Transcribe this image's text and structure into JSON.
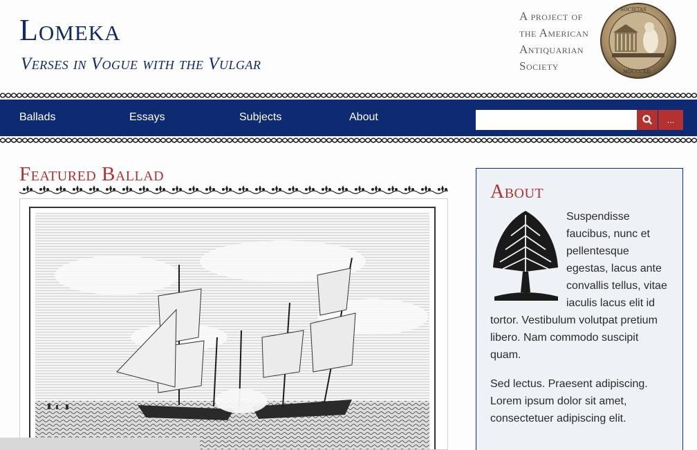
{
  "site": {
    "title": "Lomeka",
    "tagline": "Verses in Vogue with the Vulgar",
    "project_note": "A project of the American Antiquarian Society"
  },
  "nav": {
    "items": [
      {
        "label": "Ballads"
      },
      {
        "label": "Essays"
      },
      {
        "label": "Subjects"
      },
      {
        "label": "About"
      }
    ]
  },
  "search": {
    "placeholder": "",
    "value": "",
    "submit_icon": "search-icon",
    "advanced_label": "..."
  },
  "featured": {
    "heading": "Featured Ballad",
    "image_desc": "engraving-of-sailing-ships-in-battle"
  },
  "about": {
    "heading": "About",
    "paragraph1": "Suspendisse faucibus, nunc et pellentesque egestas, lacus ante convallis tellus, vitae iaculis lacus elit id tortor. Vestibulum volutpat pretium libero. Nam commodo suscipit quam.",
    "paragraph2": "Sed lectus. Praesent adipiscing. Lorem ipsum dolor sit amet, consectetuer adipiscing elit."
  },
  "colors": {
    "navy": "#0d2a73",
    "accent_red": "#b3322f",
    "panel_bg": "#eef1f6"
  }
}
